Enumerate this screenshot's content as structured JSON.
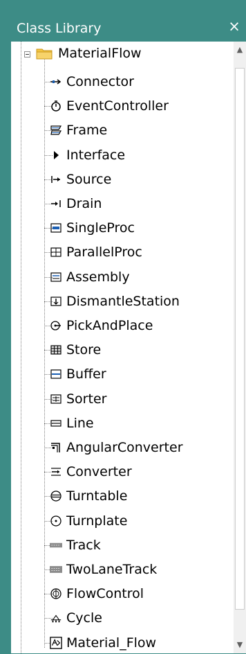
{
  "panel": {
    "title": "Class Library",
    "close_glyph": "×"
  },
  "scrollbar": {
    "up_glyph": "▲",
    "down_glyph": "▼"
  },
  "tree": {
    "root": {
      "label": "MaterialFlow",
      "expanded": true,
      "icon": "folder-icon"
    },
    "items": [
      {
        "label": "Connector",
        "icon": "connector-icon"
      },
      {
        "label": "EventController",
        "icon": "event-controller-icon"
      },
      {
        "label": "Frame",
        "icon": "frame-icon"
      },
      {
        "label": "Interface",
        "icon": "interface-icon"
      },
      {
        "label": "Source",
        "icon": "source-icon"
      },
      {
        "label": "Drain",
        "icon": "drain-icon"
      },
      {
        "label": "SingleProc",
        "icon": "single-proc-icon"
      },
      {
        "label": "ParallelProc",
        "icon": "parallel-proc-icon"
      },
      {
        "label": "Assembly",
        "icon": "assembly-icon"
      },
      {
        "label": "DismantleStation",
        "icon": "dismantle-station-icon"
      },
      {
        "label": "PickAndPlace",
        "icon": "pick-and-place-icon"
      },
      {
        "label": "Store",
        "icon": "store-icon"
      },
      {
        "label": "Buffer",
        "icon": "buffer-icon"
      },
      {
        "label": "Sorter",
        "icon": "sorter-icon"
      },
      {
        "label": "Line",
        "icon": "line-icon"
      },
      {
        "label": "AngularConverter",
        "icon": "angular-converter-icon"
      },
      {
        "label": "Converter",
        "icon": "converter-icon"
      },
      {
        "label": "Turntable",
        "icon": "turntable-icon"
      },
      {
        "label": "Turnplate",
        "icon": "turnplate-icon"
      },
      {
        "label": "Track",
        "icon": "track-icon"
      },
      {
        "label": "TwoLaneTrack",
        "icon": "two-lane-track-icon"
      },
      {
        "label": "FlowControl",
        "icon": "flow-control-icon"
      },
      {
        "label": "Cycle",
        "icon": "cycle-icon"
      },
      {
        "label": "Material_Flow",
        "icon": "material-flow-icon"
      }
    ]
  },
  "colors": {
    "panel_bg": "#3d8c86",
    "tree_bg": "#ffffff",
    "text": "#000000",
    "title_text": "#ffffff"
  }
}
